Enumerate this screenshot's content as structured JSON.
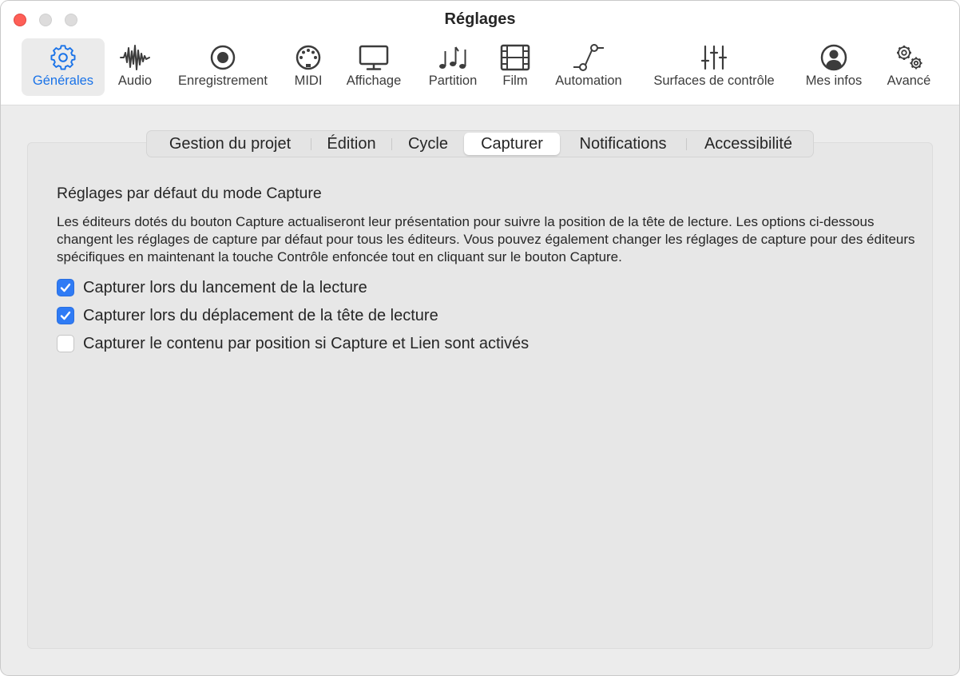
{
  "window": {
    "title": "Réglages"
  },
  "toolbar": {
    "accent_color": "#1a73e8",
    "items": [
      {
        "label": "Générales",
        "icon": "gear-icon",
        "selected": true
      },
      {
        "label": "Audio",
        "icon": "waveform-icon",
        "selected": false
      },
      {
        "label": "Enregistrement",
        "icon": "record-icon",
        "selected": false
      },
      {
        "label": "MIDI",
        "icon": "midi-connector-icon",
        "selected": false
      },
      {
        "label": "Affichage",
        "icon": "display-icon",
        "selected": false
      },
      {
        "label": "Partition",
        "icon": "music-notes-icon",
        "selected": false
      },
      {
        "label": "Film",
        "icon": "film-icon",
        "selected": false
      },
      {
        "label": "Automation",
        "icon": "automation-curve-icon",
        "selected": false
      },
      {
        "label": "Surfaces de contrôle",
        "icon": "sliders-icon",
        "selected": false
      },
      {
        "label": "Mes infos",
        "icon": "person-icon",
        "selected": false
      },
      {
        "label": "Avancé",
        "icon": "gears-icon",
        "selected": false
      }
    ]
  },
  "tabs": {
    "items": [
      {
        "label": "Gestion du projet",
        "active": false
      },
      {
        "label": "Édition",
        "active": false
      },
      {
        "label": "Cycle",
        "active": false
      },
      {
        "label": "Capturer",
        "active": true
      },
      {
        "label": "Notifications",
        "active": false
      },
      {
        "label": "Accessibilité",
        "active": false
      }
    ]
  },
  "content": {
    "section_title": "Réglages par défaut du mode Capture",
    "description": "Les éditeurs dotés du bouton Capture actualiseront leur présentation pour suivre la position de la tête de lecture. Les options ci-dessous changent les réglages de capture par défaut pour tous les éditeurs. Vous pouvez également changer les réglages de capture pour des éditeurs spécifiques en maintenant la touche Contrôle enfoncée tout en cliquant sur le bouton Capture.",
    "options": [
      {
        "label": "Capturer lors du lancement de la lecture",
        "checked": true
      },
      {
        "label": "Capturer lors du déplacement de la tête de lecture",
        "checked": true
      },
      {
        "label": "Capturer le contenu par position si Capture et Lien sont activés",
        "checked": false
      }
    ]
  }
}
